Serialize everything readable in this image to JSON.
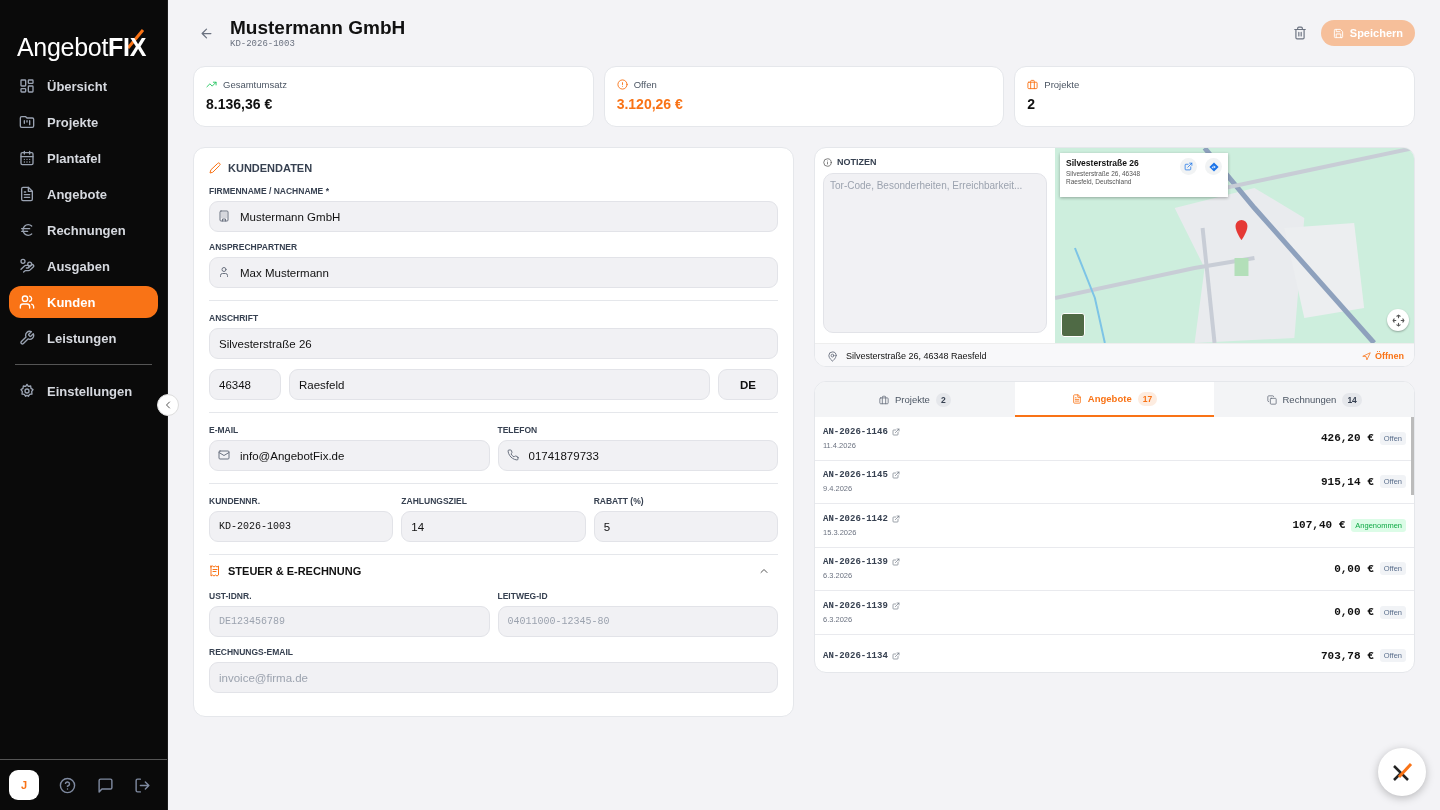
{
  "sidebar": {
    "logo": {
      "text": "Angebot",
      "accent": "FIX"
    },
    "items": [
      {
        "label": "Übersicht",
        "selected": false
      },
      {
        "label": "Projekte",
        "selected": false
      },
      {
        "label": "Plantafel",
        "selected": false
      },
      {
        "label": "Angebote",
        "selected": false
      },
      {
        "label": "Rechnungen",
        "selected": false
      },
      {
        "label": "Ausgaben",
        "selected": false
      },
      {
        "label": "Kunden",
        "selected": true
      },
      {
        "label": "Leistungen",
        "selected": false
      }
    ],
    "settings": {
      "label": "Einstellungen",
      "selected": false
    },
    "avatar": "J"
  },
  "header": {
    "title": "Mustermann GmbH",
    "subtitle": "KD-2026-1003",
    "save_button": {
      "label": "Speichern",
      "disabled": true
    }
  },
  "stats": [
    {
      "label": "Gesamtumsatz",
      "value": "8.136,36 €",
      "kind": "revenue"
    },
    {
      "label": "Offen",
      "value": "3.120,26 €",
      "kind": "open"
    },
    {
      "label": "Projekte",
      "value": "2",
      "kind": "projects"
    }
  ],
  "customer": {
    "title": "KUNDENDATEN",
    "groups": [
      {
        "rows": [
          {
            "fields": [
              {
                "label": "FIRMENNAME / NACHNAME *",
                "value": "Mustermann GmbH",
                "kind": "company"
              }
            ]
          },
          {
            "fields": [
              {
                "label": "ANSPRECHPARTNER",
                "value": "Max Mustermann",
                "kind": "person"
              }
            ]
          }
        ]
      },
      {
        "rows": [
          {
            "label": "ANSCHRIFT",
            "fields": [
              {
                "value": "Silvesterstraße 26",
                "kind": "plain"
              }
            ]
          },
          {
            "fields": [
              {
                "value": "46348",
                "kind": "zip"
              },
              {
                "value": "Raesfeld",
                "kind": "plain"
              },
              {
                "value": "DE",
                "kind": "country"
              }
            ]
          }
        ]
      },
      {
        "rows": [
          {
            "fields": [
              {
                "label": "E-MAIL",
                "value": "info@AngebotFix.de",
                "kind": "email"
              },
              {
                "label": "TELEFON",
                "value": "01741879733",
                "kind": "phone"
              }
            ]
          }
        ]
      },
      {
        "rows": [
          {
            "fields": [
              {
                "label": "KUNDENNR.",
                "value": "KD-2026-1003",
                "kind": "code"
              },
              {
                "label": "ZAHLUNGSZIEL",
                "value": "14",
                "kind": "plain"
              },
              {
                "label": "RABATT (%)",
                "value": "5",
                "kind": "plain"
              }
            ]
          }
        ]
      }
    ],
    "tax": {
      "title": "STEUER & E-RECHNUNG",
      "expanded": true,
      "rows": [
        {
          "fields": [
            {
              "label": "UST-IDNR.",
              "placeholder": "DE123456789",
              "kind": "code"
            },
            {
              "label": "LEITWEG-ID",
              "placeholder": "04011000-12345-80",
              "kind": "code"
            }
          ]
        },
        {
          "fields": [
            {
              "label": "RECHNUNGS-EMAIL",
              "placeholder": "invoice@firma.de",
              "kind": "plain"
            }
          ]
        }
      ]
    }
  },
  "notes": {
    "title": "NOTIZEN",
    "placeholder": "Tor-Code, Besonderheiten, Erreichbarkeit..."
  },
  "map": {
    "kind": "picture",
    "place": {
      "title": "Silvesterstraße 26",
      "lines": [
        "Silvesterstraße 26, 46348",
        "Raesfeld, Deutschland"
      ]
    },
    "address": "Silvesterstraße 26, 46348 Raesfeld",
    "open_link": "Öffnen"
  },
  "documents": {
    "tabs": [
      {
        "label": "Projekte",
        "count": "2",
        "selected": false
      },
      {
        "label": "Angebote",
        "count": "17",
        "selected": true
      },
      {
        "label": "Rechnungen",
        "count": "14",
        "selected": false
      }
    ],
    "rows": [
      {
        "number": "AN-2026-1146",
        "date": "11.4.2026",
        "amount": "426,20 €",
        "status": "Offen",
        "color": "#f1f3f6"
      },
      {
        "number": "AN-2026-1145",
        "date": "9.4.2026",
        "amount": "915,14 €",
        "status": "Offen",
        "color": "#f1f3f6"
      },
      {
        "number": "AN-2026-1142",
        "date": "15.3.2026",
        "amount": "107,40 €",
        "status": "Angenommen",
        "color": "#dcfce7"
      },
      {
        "number": "AN-2026-1139",
        "date": "6.3.2026",
        "amount": "0,00 €",
        "status": "Offen",
        "color": "#f1f3f6"
      },
      {
        "number": "AN-2026-1139",
        "date": "6.3.2026",
        "amount": "0,00 €",
        "status": "Offen",
        "color": "#f1f3f6"
      },
      {
        "number": "AN-2026-1134",
        "amount": "703,78 €",
        "status": "Offen",
        "color": "#f1f3f6"
      }
    ]
  }
}
